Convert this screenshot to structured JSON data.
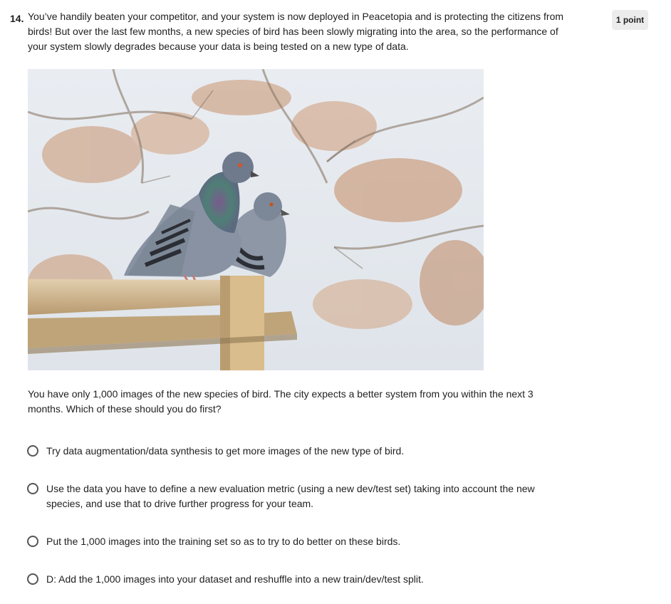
{
  "question": {
    "number": "14.",
    "points": "1 point",
    "prompt": "You’ve handily beaten your competitor, and your system is now deployed in Peacetopia and is protecting the citizens from birds! But over the last few months, a new species of bird has been slowly migrating into the area, so the performance of your system slowly degrades because your data is being tested on a new type of data.",
    "followup": "You have only 1,000 images of the new species of bird. The city expects a better system from you within the next 3 months. Which of these should you do first?",
    "options": [
      {
        "label": "Try data augmentation/data synthesis to get more images of the new type of bird."
      },
      {
        "label": "Use the data you have to define a new evaluation metric (using a new dev/test set) taking into account the new species, and use that to drive further progress for your team."
      },
      {
        "label": "Put the 1,000 images into the training set so as to try to do better on these birds."
      },
      {
        "label": "D: Add the 1,000 images into your dataset and reshuffle into a new train/dev/test split."
      }
    ]
  },
  "colors": {
    "text": "#1f1f1f",
    "badge_bg": "#ececec",
    "radio_border": "#555555"
  },
  "icons": {
    "option_selector": "radio-button-icon"
  }
}
